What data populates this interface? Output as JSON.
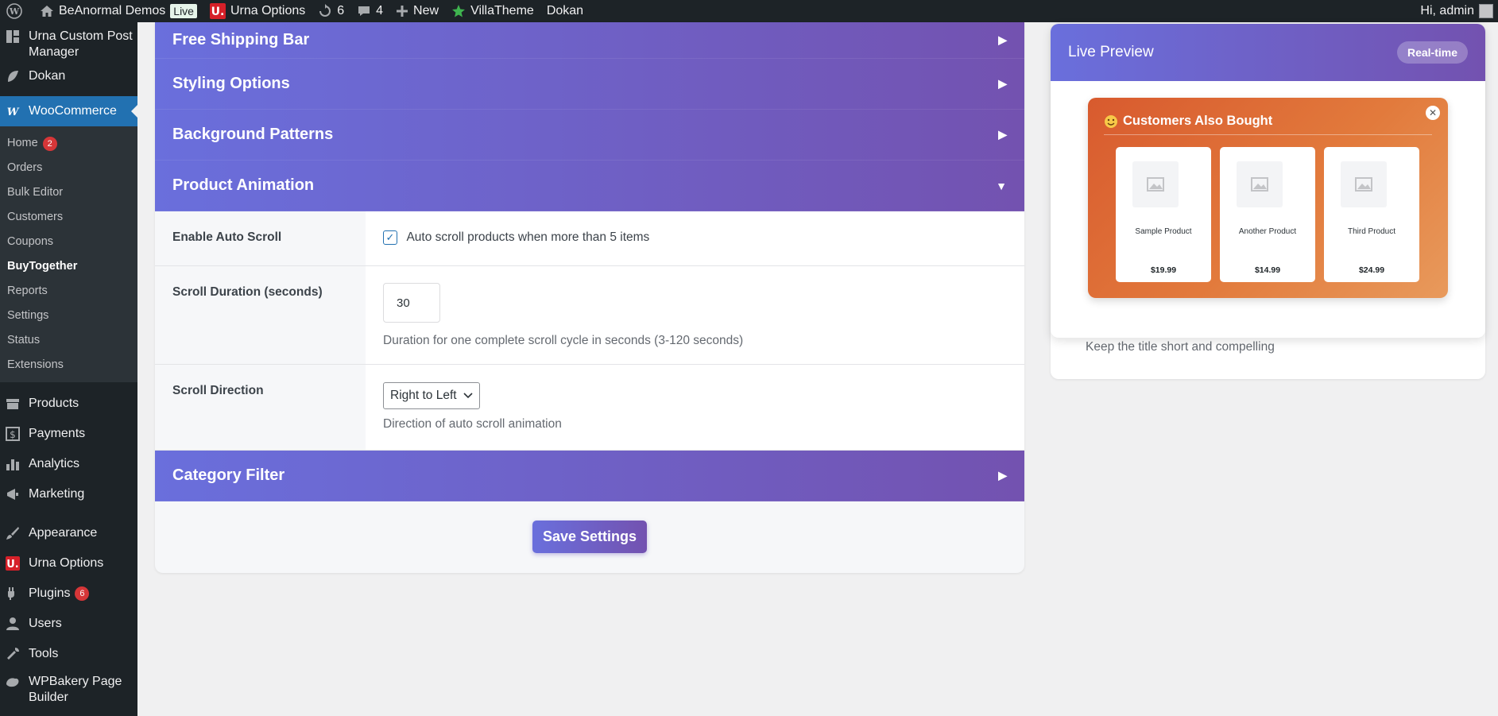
{
  "admin_bar": {
    "site_name": "BeAnormal Demos",
    "live_badge": "Live",
    "urna_options": "Urna Options",
    "updates_count": "6",
    "comments_count": "4",
    "new_label": "New",
    "villatheme": "VillaTheme",
    "dokan": "Dokan",
    "greeting": "Hi, admin"
  },
  "sidebar": {
    "top_items": [
      {
        "label": "Urna Custom Post Manager",
        "icon": "grid-icon"
      },
      {
        "label": "Dokan",
        "icon": "dokan-icon"
      }
    ],
    "woocommerce": {
      "label": "WooCommerce",
      "icon": "woo-icon"
    },
    "submenu": [
      {
        "label": "Home",
        "badge": "2"
      },
      {
        "label": "Orders"
      },
      {
        "label": "Bulk Editor"
      },
      {
        "label": "Customers"
      },
      {
        "label": "Coupons"
      },
      {
        "label": "BuyTogether",
        "current": true
      },
      {
        "label": "Reports"
      },
      {
        "label": "Settings"
      },
      {
        "label": "Status"
      },
      {
        "label": "Extensions"
      }
    ],
    "bottom_items": [
      {
        "label": "Products",
        "icon": "archive-icon"
      },
      {
        "label": "Payments",
        "icon": "dollar-icon"
      },
      {
        "label": "Analytics",
        "icon": "bar-chart-icon"
      },
      {
        "label": "Marketing",
        "icon": "megaphone-icon"
      },
      {
        "label": "Appearance",
        "icon": "paintbrush-icon"
      },
      {
        "label": "Urna Options",
        "icon": "urna-icon"
      },
      {
        "label": "Plugins",
        "icon": "plug-icon",
        "badge": "6"
      },
      {
        "label": "Users",
        "icon": "user-icon"
      },
      {
        "label": "Tools",
        "icon": "wrench-icon"
      },
      {
        "label": "WPBakery Page Builder",
        "icon": "wpbakery-icon"
      }
    ]
  },
  "sections": {
    "free_shipping": "Free Shipping Bar",
    "styling": "Styling Options",
    "background": "Background Patterns",
    "animation": "Product Animation",
    "category": "Category Filter"
  },
  "animation_settings": {
    "auto_scroll_label": "Enable Auto Scroll",
    "auto_scroll_text": "Auto scroll products when more than 5 items",
    "auto_scroll_checked": true,
    "duration_label": "Scroll Duration (seconds)",
    "duration_value": "30",
    "duration_desc": "Duration for one complete scroll cycle in seconds (3-120 seconds)",
    "direction_label": "Scroll Direction",
    "direction_value": "Right to Left",
    "direction_desc": "Direction of auto scroll animation"
  },
  "save_label": "Save Settings",
  "preview": {
    "title": "Live Preview",
    "badge": "Real-time",
    "popup_title": "Customers Also Bought",
    "products": [
      {
        "name": "Sample Product",
        "price": "$19.99"
      },
      {
        "name": "Another Product",
        "price": "$14.99"
      },
      {
        "name": "Third Product",
        "price": "$24.99"
      }
    ],
    "tip": "Keep the title short and compelling"
  },
  "colors": {
    "accent_start": "#6a6fdc",
    "accent_end": "#7352b0",
    "popup_orange": "#d85a2e",
    "wp_admin_bg": "#1d2327",
    "wp_blue": "#2271b1"
  }
}
